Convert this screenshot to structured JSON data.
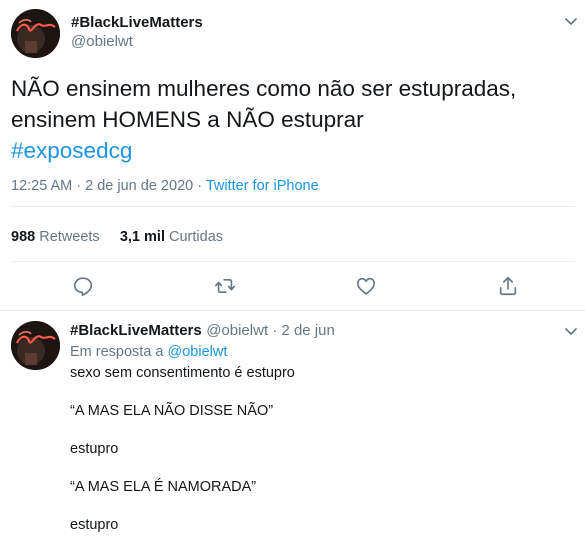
{
  "tweet": {
    "display_name": "#BlackLiveMatters",
    "handle": "@obielwt",
    "text_line_1": "NÃO ensinem mulheres como não ser estupradas,",
    "text_line_2": "ensinem HOMENS a NÃO estuprar",
    "hashtag": "#exposedcg",
    "time": "12:25 AM · 2 de jun de 2020 · ",
    "source": "Twitter for iPhone",
    "retweets_count": "988",
    "retweets_label": "Retweets",
    "likes_count": "3,1 mil",
    "likes_label": "Curtidas"
  },
  "actions": {
    "icons": [
      "reply-icon",
      "retweet-icon",
      "like-icon",
      "share-icon"
    ]
  },
  "reply": {
    "display_name": "#BlackLiveMatters",
    "handle_date": "@obielwt · 2 de jun",
    "in_reply_prefix": "Em resposta a ",
    "in_reply_handle": "@obielwt",
    "lines": [
      "sexo sem consentimento é estupro",
      "“A MAS ELA NÃO DISSE NÃO”",
      "estupro",
      "“A MAS ELA É NAMORADA”",
      "estupro"
    ]
  },
  "colors": {
    "accent": "#1b95e0",
    "secondary_text": "#657786",
    "divider": "#e6ecf0"
  }
}
